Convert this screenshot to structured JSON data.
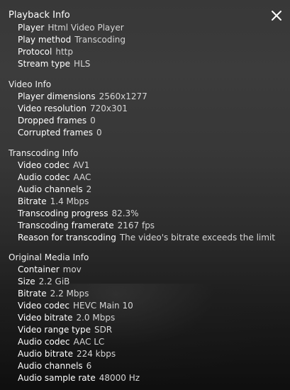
{
  "header": {
    "title": "Playback Info",
    "close_icon": "close-icon"
  },
  "sections": [
    {
      "title": "",
      "rows": [
        {
          "label": "Player",
          "value": "Html Video Player"
        },
        {
          "label": "Play method",
          "value": "Transcoding"
        },
        {
          "label": "Protocol",
          "value": "http"
        },
        {
          "label": "Stream type",
          "value": "HLS"
        }
      ]
    },
    {
      "title": "Video Info",
      "rows": [
        {
          "label": "Player dimensions",
          "value": "2560x1277"
        },
        {
          "label": "Video resolution",
          "value": "720x301"
        },
        {
          "label": "Dropped frames",
          "value": "0"
        },
        {
          "label": "Corrupted frames",
          "value": "0"
        }
      ]
    },
    {
      "title": "Transcoding Info",
      "rows": [
        {
          "label": "Video codec",
          "value": "AV1"
        },
        {
          "label": "Audio codec",
          "value": "AAC"
        },
        {
          "label": "Audio channels",
          "value": "2"
        },
        {
          "label": "Bitrate",
          "value": "1.4 Mbps"
        },
        {
          "label": "Transcoding progress",
          "value": "82.3%"
        },
        {
          "label": "Transcoding framerate",
          "value": "2167 fps"
        },
        {
          "label": "Reason for transcoding",
          "value": "The video's bitrate exceeds the limit"
        }
      ]
    },
    {
      "title": "Original Media Info",
      "rows": [
        {
          "label": "Container",
          "value": "mov"
        },
        {
          "label": "Size",
          "value": "2.2 GiB"
        },
        {
          "label": "Bitrate",
          "value": "2.2 Mbps"
        },
        {
          "label": "Video codec",
          "value": "HEVC Main 10"
        },
        {
          "label": "Video bitrate",
          "value": "2.0 Mbps"
        },
        {
          "label": "Video range type",
          "value": "SDR"
        },
        {
          "label": "Audio codec",
          "value": "AAC LC"
        },
        {
          "label": "Audio bitrate",
          "value": "224 kbps"
        },
        {
          "label": "Audio channels",
          "value": "6"
        },
        {
          "label": "Audio sample rate",
          "value": "48000 Hz"
        }
      ]
    }
  ]
}
